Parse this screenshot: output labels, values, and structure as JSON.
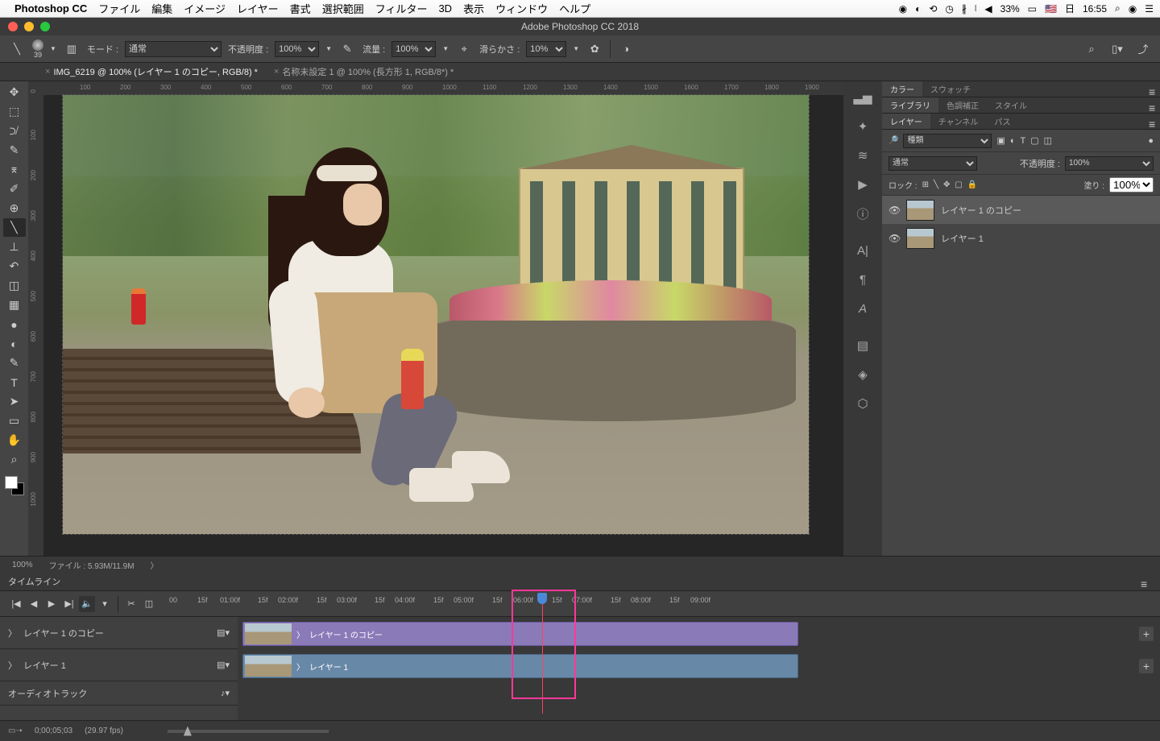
{
  "menubar": {
    "app": "Photoshop CC",
    "items": [
      "ファイル",
      "編集",
      "イメージ",
      "レイヤー",
      "書式",
      "選択範囲",
      "フィルター",
      "3D",
      "表示",
      "ウィンドウ",
      "ヘルプ"
    ],
    "battery": "33%",
    "day": "日",
    "time": "16:55"
  },
  "window_title": "Adobe Photoshop CC 2018",
  "options": {
    "brush_size": "39",
    "mode_label": "モード :",
    "mode_value": "通常",
    "opacity_label": "不透明度 :",
    "opacity": "100%",
    "flow_label": "流量 :",
    "flow": "100%",
    "smooth_label": "滑らかさ :",
    "smooth": "10%"
  },
  "tabs": [
    {
      "name": "IMG_6219 @ 100% (レイヤー 1 のコピー, RGB/8) *",
      "active": true
    },
    {
      "name": "名称未設定 1 @ 100% (長方形 1, RGB/8*) *",
      "active": false
    }
  ],
  "rulerh": [
    "100",
    "200",
    "300",
    "400",
    "500",
    "600",
    "700",
    "800",
    "900",
    "1000",
    "1100",
    "1200",
    "1300",
    "1400",
    "1500",
    "1600",
    "1700",
    "1800",
    "1900"
  ],
  "rulerv": [
    "0",
    "100",
    "200",
    "300",
    "400",
    "500",
    "600",
    "700",
    "800",
    "900",
    "1000"
  ],
  "status": {
    "zoom": "100%",
    "docinfo": "ファイル : 5.93M/11.9M"
  },
  "panel_tabs": {
    "color": [
      "カラー",
      "スウォッチ"
    ],
    "lib": [
      "ライブラリ",
      "色調補正",
      "スタイル"
    ],
    "layer": [
      "レイヤー",
      "チャンネル",
      "パス"
    ]
  },
  "layers": {
    "filter": "種類",
    "blend": "通常",
    "opacity_label": "不透明度 :",
    "opacity": "100%",
    "lock_label": "ロック :",
    "fill_label": "塗り :",
    "fill": "100%",
    "items": [
      {
        "name": "レイヤー 1 のコピー",
        "sel": true
      },
      {
        "name": "レイヤー 1",
        "sel": false
      }
    ]
  },
  "timeline": {
    "title": "タイムライン",
    "ruler": [
      "00",
      "15f",
      "01:00f",
      "15f",
      "02:00f",
      "15f",
      "03:00f",
      "15f",
      "04:00f",
      "15f",
      "05:00f",
      "15f",
      "06:00f",
      "15f",
      "07:00f",
      "15f",
      "08:00f",
      "15f",
      "09:00f"
    ],
    "tracks": [
      {
        "name": "レイヤー 1 のコピー"
      },
      {
        "name": "レイヤー 1"
      }
    ],
    "audio": "オーディオトラック",
    "clip1": "レイヤー 1 のコピー",
    "clip2": "レイヤー 1",
    "time": "0;00;05;03",
    "fps": "(29.97 fps)"
  }
}
